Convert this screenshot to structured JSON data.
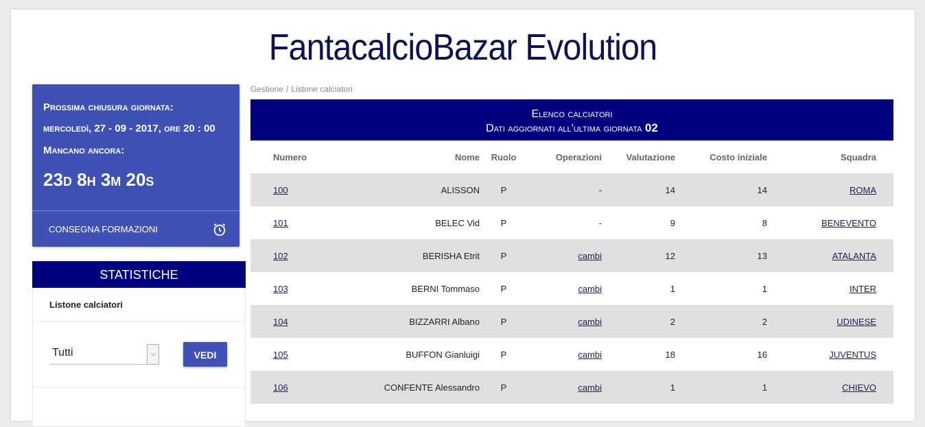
{
  "site": {
    "title": "FantacalcioBazar Evolution"
  },
  "countdown": {
    "line1": "Prossima chiusura giornata:",
    "line2": "mercoledì, 27 - 09 - 2017, ore 20 : 00",
    "line3": "Mancano ancora:",
    "remaining": "23d 8h 3m 20s",
    "action": "Consegna formazioni",
    "action_icon": "alarm-clock-icon"
  },
  "stats": {
    "title": "STATISTICHE",
    "subtitle": "Listone calciatori",
    "select_value": "Tutti",
    "button": "VEDI"
  },
  "breadcrumb": {
    "root": "Gestione",
    "separator": "/",
    "current": "Listone calciatori"
  },
  "table": {
    "header_line1": "Elenco calciatori",
    "header_line2": "Dati aggiornati all'ultima giornata",
    "giornata": "02",
    "columns": [
      "Numero",
      "Nome",
      "Ruolo",
      "Operazioni",
      "Valutazione",
      "Costo iniziale",
      "Squadra"
    ],
    "rows": [
      {
        "numero": "100",
        "nome": "ALISSON",
        "ruolo": "P",
        "operazioni": "-",
        "valutazione": "14",
        "costo": "14",
        "squadra": "ROMA"
      },
      {
        "numero": "101",
        "nome": "BELEC Vid",
        "ruolo": "P",
        "operazioni": "-",
        "valutazione": "9",
        "costo": "8",
        "squadra": "BENEVENTO"
      },
      {
        "numero": "102",
        "nome": "BERISHA Etrit",
        "ruolo": "P",
        "operazioni": "cambi",
        "valutazione": "12",
        "costo": "13",
        "squadra": "ATALANTA"
      },
      {
        "numero": "103",
        "nome": "BERNI Tommaso",
        "ruolo": "P",
        "operazioni": "cambi",
        "valutazione": "1",
        "costo": "1",
        "squadra": "INTER"
      },
      {
        "numero": "104",
        "nome": "BIZZARRI Albano",
        "ruolo": "P",
        "operazioni": "cambi",
        "valutazione": "2",
        "costo": "2",
        "squadra": "UDINESE"
      },
      {
        "numero": "105",
        "nome": "BUFFON Gianluigi",
        "ruolo": "P",
        "operazioni": "cambi",
        "valutazione": "18",
        "costo": "16",
        "squadra": "JUVENTUS"
      },
      {
        "numero": "106",
        "nome": "CONFENTE Alessandro",
        "ruolo": "P",
        "operazioni": "cambi",
        "valutazione": "1",
        "costo": "1",
        "squadra": "CHIEVO"
      }
    ]
  },
  "colors": {
    "primary": "#3f51b5",
    "navy": "#000080",
    "title": "#0d1250",
    "row_alt": "#e0e0e0"
  }
}
